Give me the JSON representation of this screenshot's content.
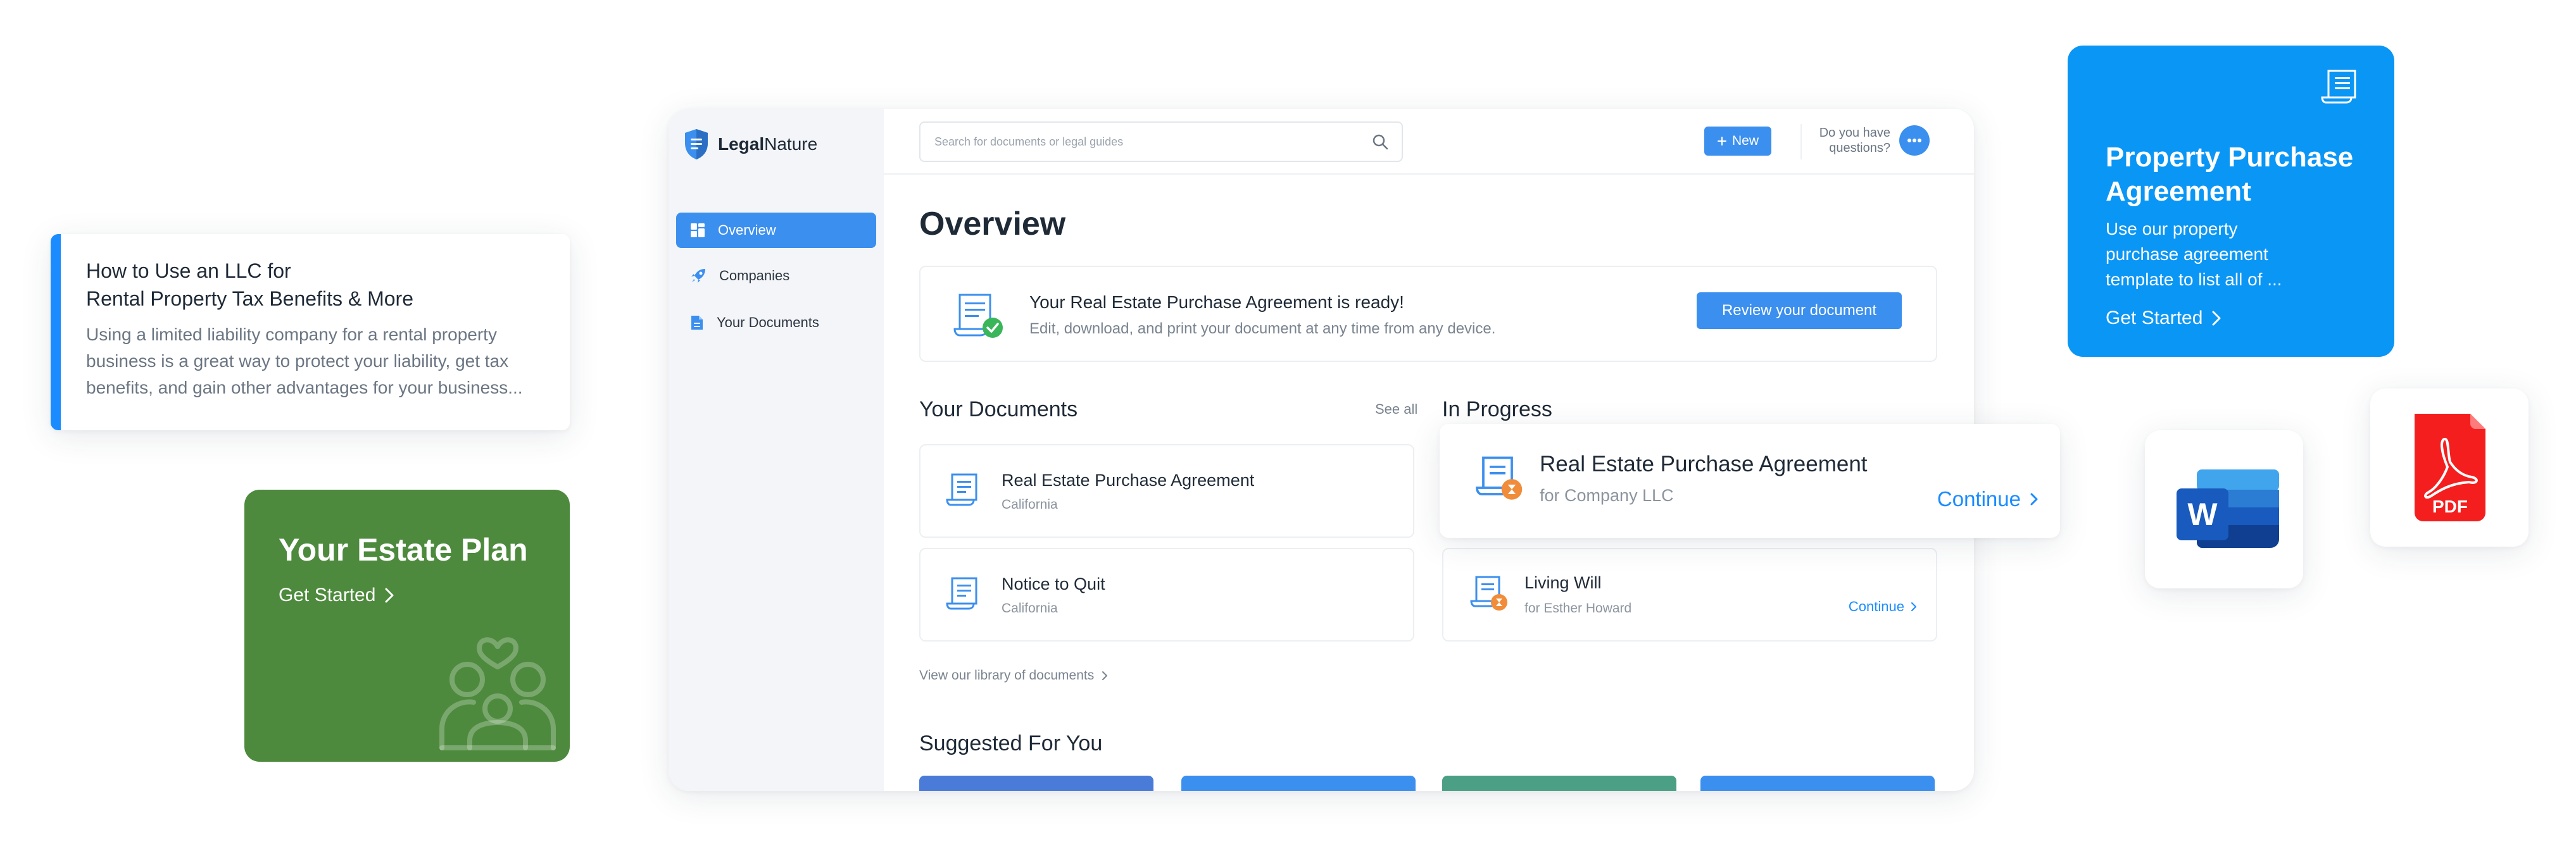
{
  "article_card": {
    "title_line1": "How to Use an LLC for",
    "title_line2": "Rental Property Tax Benefits & More",
    "excerpt": "Using a limited liability company for a rental property business is a great way to protect your liability, get tax benefits, and gain other advantages for your business..."
  },
  "estate_card": {
    "title": "Your Estate Plan",
    "cta": "Get Started",
    "color": "#4d8a3d"
  },
  "app": {
    "logo": {
      "bold": "Legal",
      "regular": "Nature"
    },
    "sidebar": {
      "items": [
        {
          "label": "Overview",
          "icon": "dashboard-grid-icon",
          "active": true
        },
        {
          "label": "Companies",
          "icon": "rocket-icon",
          "active": false
        },
        {
          "label": "Your Documents",
          "icon": "document-icon",
          "active": false
        }
      ]
    },
    "topbar": {
      "search_placeholder": "Search for documents or legal guides",
      "new_label": "New",
      "questions_line1": "Do you have",
      "questions_line2": "questions?"
    },
    "page_title": "Overview",
    "ready_banner": {
      "title": "Your Real Estate Purchase Agreement is ready!",
      "subtitle": "Edit, download, and print your document at any time from any device.",
      "button": "Review your document"
    },
    "your_documents": {
      "title": "Your Documents",
      "see_all": "See all",
      "items": [
        {
          "title": "Real Estate Purchase Agreement",
          "subtitle": "California"
        },
        {
          "title": "Notice to Quit",
          "subtitle": "California"
        }
      ],
      "library_link": "View our library of documents"
    },
    "in_progress": {
      "title": "In Progress",
      "items": [
        {
          "title": "Real Estate Purchase Agreement",
          "subtitle": "for Company LLC",
          "action": "Continue"
        },
        {
          "title": "Living Will",
          "subtitle": "for Esther Howard",
          "action": "Continue"
        }
      ]
    },
    "suggested": {
      "title": "Suggested For You",
      "colors": [
        "#4a7bd8",
        "#3b8fee",
        "#4a9f84",
        "#3b8fee"
      ]
    },
    "accent_color": "#3b8fee"
  },
  "ppa_card": {
    "title": "Property Purchase Agreement",
    "description": "Use our property purchase agreement template to list all of ...",
    "cta": "Get Started",
    "color": "#0a96f5"
  },
  "file_types": {
    "word_letter": "W",
    "pdf_label": "PDF"
  }
}
